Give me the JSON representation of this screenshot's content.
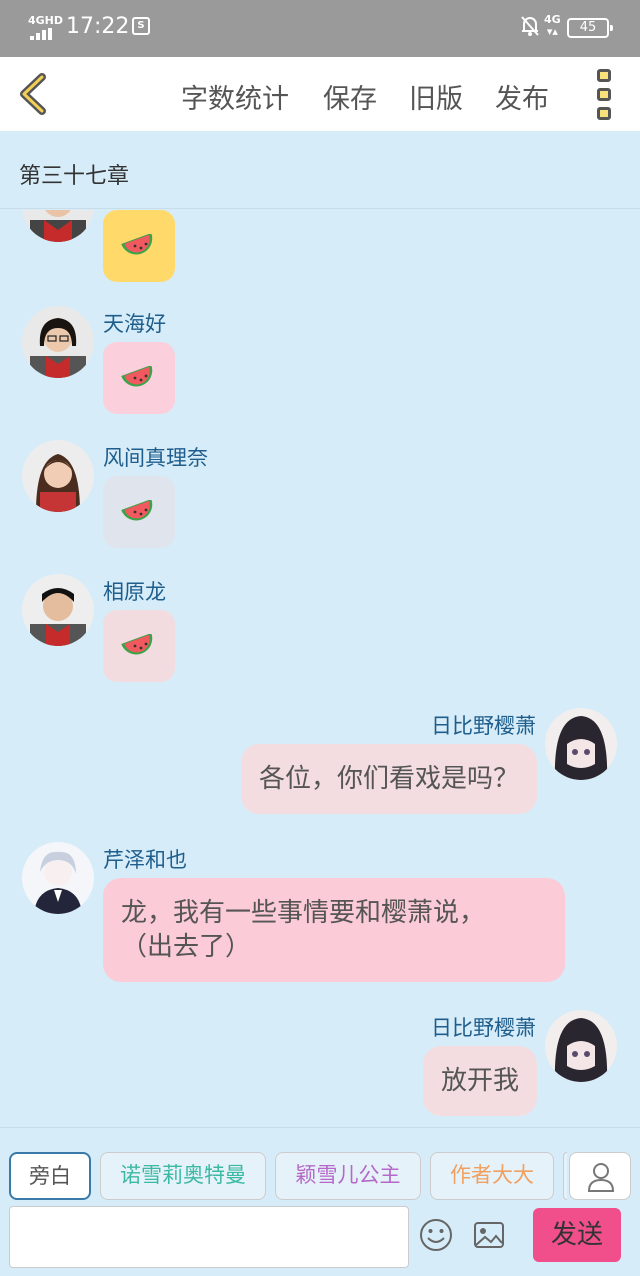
{
  "status_bar": {
    "network": "4GHD",
    "time": "17:22",
    "net_right": "4G",
    "battery": "45"
  },
  "header": {
    "actions": [
      "字数统计",
      "保存",
      "旧版",
      "发布"
    ]
  },
  "chapter": {
    "title": "第三十七章"
  },
  "messages": [
    {
      "side": "left",
      "name": "",
      "type": "sticker",
      "sticker_color": "#ffd96a"
    },
    {
      "side": "left",
      "name": "天海好",
      "type": "sticker",
      "sticker_color": "#fbd0dc"
    },
    {
      "side": "left",
      "name": "风间真理奈",
      "type": "sticker",
      "sticker_color": "#e0e4ec"
    },
    {
      "side": "left",
      "name": "相原龙",
      "type": "sticker",
      "sticker_color": "#f3dce0"
    },
    {
      "side": "right",
      "name": "日比野樱萧",
      "type": "text",
      "text": "各位，你们看戏是吗？"
    },
    {
      "side": "left",
      "name": "芹泽和也",
      "type": "text",
      "lines": [
        "龙，我有一些事情要和樱萧说，",
        "（出去了）"
      ]
    },
    {
      "side": "right",
      "name": "日比野樱萧",
      "type": "text",
      "text": "放开我"
    }
  ],
  "chips": [
    {
      "label": "旁白",
      "color": "#555555"
    },
    {
      "label": "诺雪莉奥特曼",
      "color": "#3cb9a4"
    },
    {
      "label": "颖雪儿公主",
      "color": "#b468c8"
    },
    {
      "label": "作者大大",
      "color": "#f0a060"
    }
  ],
  "input": {
    "send_label": "发送",
    "placeholder": ""
  },
  "colors": {
    "background": "#d6ecf8",
    "name_text": "#1f5e8c",
    "bubble": "#f3dde0",
    "bubble_pink": "#fccbd8",
    "send": "#f04f8c"
  },
  "icons": [
    "back-chevron-icon",
    "menu-dots-icon",
    "watermelon-icon",
    "person-icon",
    "emoji-icon",
    "image-icon"
  ]
}
